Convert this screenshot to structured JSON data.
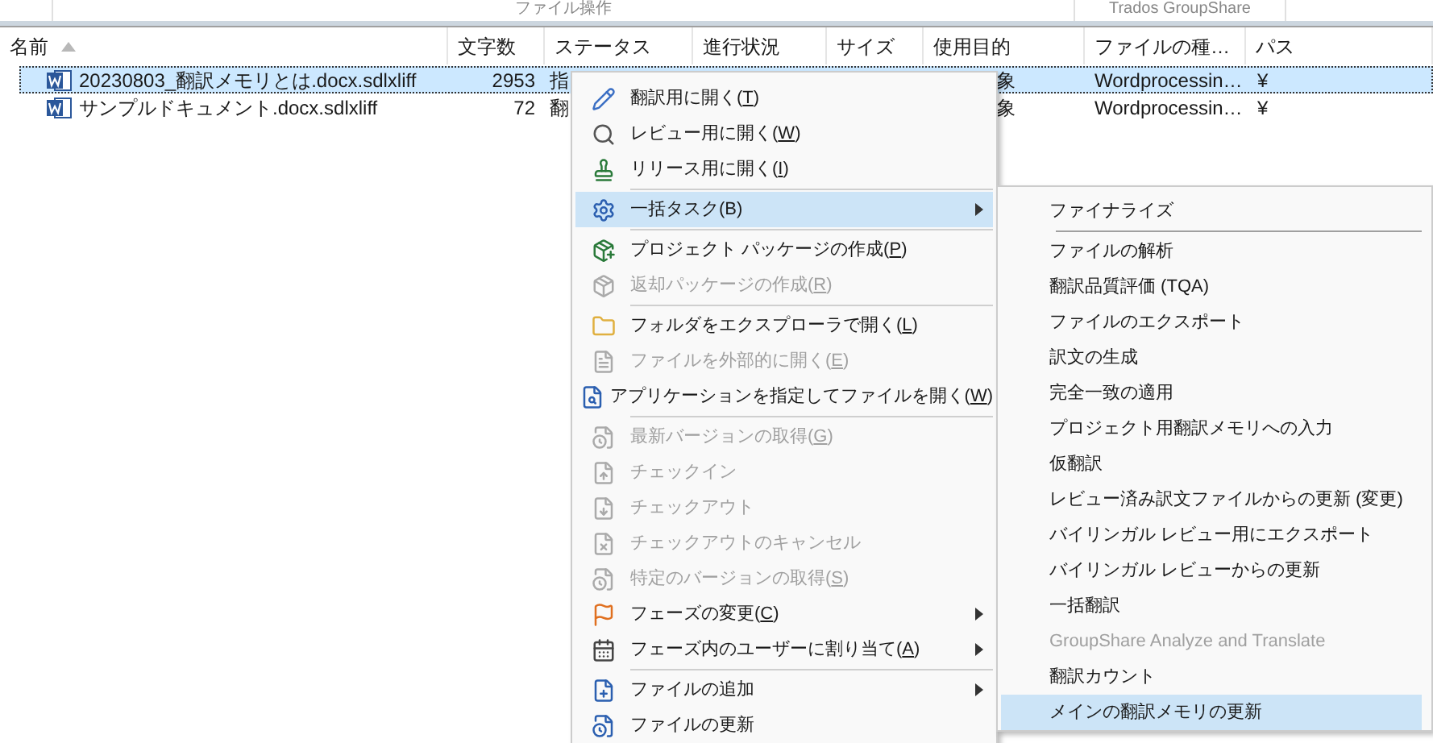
{
  "ribbon": {
    "groups": [
      "ファイル操作",
      "Trados GroupShare"
    ]
  },
  "table": {
    "columns": [
      "名前",
      "文字数",
      "ステータス",
      "進行状況",
      "サイズ",
      "使用目的",
      "ファイルの種…",
      "パス"
    ],
    "rows": [
      {
        "name": "20230803_翻訳メモリとは.docx.sdlxliff",
        "chars": "2953",
        "status": "指",
        "purpose": "象",
        "file_type": "Wordprocessin…",
        "path": "¥",
        "selected": true
      },
      {
        "name": "サンプルドキュメント.docx.sdlxliff",
        "chars": "72",
        "status": "翻",
        "purpose": "象",
        "file_type": "Wordprocessin…",
        "path": "¥",
        "selected": false
      }
    ]
  },
  "context_menu": {
    "items": [
      {
        "kind": "item",
        "label": "翻訳用に開く(T)",
        "mnemonic": true,
        "disabled": false,
        "submenu": false,
        "selected": false
      },
      {
        "kind": "item",
        "label": "レビュー用に開く(W)",
        "mnemonic": true,
        "disabled": false,
        "submenu": false,
        "selected": false
      },
      {
        "kind": "item",
        "label": "リリース用に開く(I)",
        "mnemonic": true,
        "disabled": false,
        "submenu": false,
        "selected": false
      },
      {
        "kind": "separator"
      },
      {
        "kind": "item",
        "label": "一括タスク(B)",
        "mnemonic": false,
        "disabled": false,
        "submenu": true,
        "selected": true
      },
      {
        "kind": "separator"
      },
      {
        "kind": "item",
        "label": "プロジェクト パッケージの作成(P)",
        "mnemonic": true,
        "disabled": false,
        "submenu": false,
        "selected": false
      },
      {
        "kind": "item",
        "label": "返却パッケージの作成(R)",
        "mnemonic": true,
        "disabled": true,
        "submenu": false,
        "selected": false
      },
      {
        "kind": "separator"
      },
      {
        "kind": "item",
        "label": "フォルダをエクスプローラで開く(L)",
        "mnemonic": true,
        "disabled": false,
        "submenu": false,
        "selected": false
      },
      {
        "kind": "item",
        "label": "ファイルを外部的に開く(E)",
        "mnemonic": true,
        "disabled": true,
        "submenu": false,
        "selected": false
      },
      {
        "kind": "item",
        "label": "アプリケーションを指定してファイルを開く(W)",
        "mnemonic": true,
        "disabled": false,
        "submenu": false,
        "selected": false
      },
      {
        "kind": "separator"
      },
      {
        "kind": "item",
        "label": "最新バージョンの取得(G)",
        "mnemonic": true,
        "disabled": true,
        "submenu": false,
        "selected": false
      },
      {
        "kind": "item",
        "label": "チェックイン",
        "mnemonic": false,
        "disabled": true,
        "submenu": false,
        "selected": false
      },
      {
        "kind": "item",
        "label": "チェックアウト",
        "mnemonic": false,
        "disabled": true,
        "submenu": false,
        "selected": false
      },
      {
        "kind": "item",
        "label": "チェックアウトのキャンセル",
        "mnemonic": false,
        "disabled": true,
        "submenu": false,
        "selected": false
      },
      {
        "kind": "item",
        "label": "特定のバージョンの取得(S)",
        "mnemonic": true,
        "disabled": true,
        "submenu": false,
        "selected": false
      },
      {
        "kind": "item",
        "label": "フェーズの変更(C)",
        "mnemonic": true,
        "disabled": false,
        "submenu": true,
        "selected": false
      },
      {
        "kind": "item",
        "label": "フェーズ内のユーザーに割り当て(A)",
        "mnemonic": true,
        "disabled": false,
        "submenu": true,
        "selected": false
      },
      {
        "kind": "separator"
      },
      {
        "kind": "item",
        "label": "ファイルの追加",
        "mnemonic": false,
        "disabled": false,
        "submenu": true,
        "selected": false
      },
      {
        "kind": "item",
        "label": "ファイルの更新",
        "mnemonic": false,
        "disabled": false,
        "submenu": false,
        "selected": false
      }
    ]
  },
  "submenu": {
    "items": [
      {
        "kind": "item",
        "label": "ファイナライズ",
        "disabled": false,
        "selected": false
      },
      {
        "kind": "separator"
      },
      {
        "kind": "item",
        "label": "ファイルの解析",
        "disabled": false,
        "selected": false
      },
      {
        "kind": "item",
        "label": "翻訳品質評価 (TQA)",
        "disabled": false,
        "selected": false
      },
      {
        "kind": "item",
        "label": "ファイルのエクスポート",
        "disabled": false,
        "selected": false
      },
      {
        "kind": "item",
        "label": "訳文の生成",
        "disabled": false,
        "selected": false
      },
      {
        "kind": "item",
        "label": "完全一致の適用",
        "disabled": false,
        "selected": false
      },
      {
        "kind": "item",
        "label": "プロジェクト用翻訳メモリへの入力",
        "disabled": false,
        "selected": false
      },
      {
        "kind": "item",
        "label": "仮翻訳",
        "disabled": false,
        "selected": false
      },
      {
        "kind": "item",
        "label": "レビュー済み訳文ファイルからの更新 (変更)",
        "disabled": false,
        "selected": false
      },
      {
        "kind": "item",
        "label": "バイリンガル レビュー用にエクスポート",
        "disabled": false,
        "selected": false
      },
      {
        "kind": "item",
        "label": "バイリンガル レビューからの更新",
        "disabled": false,
        "selected": false
      },
      {
        "kind": "item",
        "label": "一括翻訳",
        "disabled": false,
        "selected": false
      },
      {
        "kind": "item",
        "label": "GroupShare Analyze and Translate",
        "disabled": true,
        "selected": false
      },
      {
        "kind": "item",
        "label": "翻訳カウント",
        "disabled": false,
        "selected": false
      },
      {
        "kind": "item",
        "label": "メインの翻訳メモリの更新",
        "disabled": false,
        "selected": true
      }
    ]
  }
}
